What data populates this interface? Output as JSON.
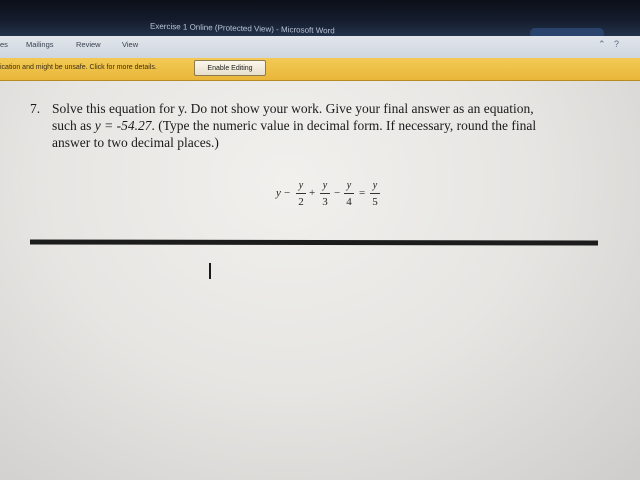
{
  "window": {
    "title": "Exercise 1 Online (Protected View) - Microsoft Word"
  },
  "ribbon": {
    "tabs": [
      "es",
      "Mailings",
      "Review",
      "View"
    ]
  },
  "message_bar": {
    "text": "ication and might be unsafe. Click for more details.",
    "button_label": "Enable Editing"
  },
  "question": {
    "number": "7.",
    "line1": "Solve this equation for y. Do not show your work. Give your final answer as an equation,",
    "line2_prefix": "such as ",
    "line2_example": "y = -54.27",
    "line2_suffix": ". (Type the numeric value in decimal form. If necessary, round the final",
    "line3": "answer to two decimal places.)"
  },
  "equation": {
    "lead": "y",
    "op1": "−",
    "f1_num": "y",
    "f1_den": "2",
    "op2": "+",
    "f2_num": "y",
    "f2_den": "3",
    "op3": "−",
    "f3_num": "y",
    "f3_den": "4",
    "op4": "=",
    "f4_num": "y",
    "f4_den": "5"
  },
  "colors": {
    "message_bar": "#e9b63a",
    "title_bar": "#141c2c",
    "answer_line": "#1c1c1c"
  }
}
